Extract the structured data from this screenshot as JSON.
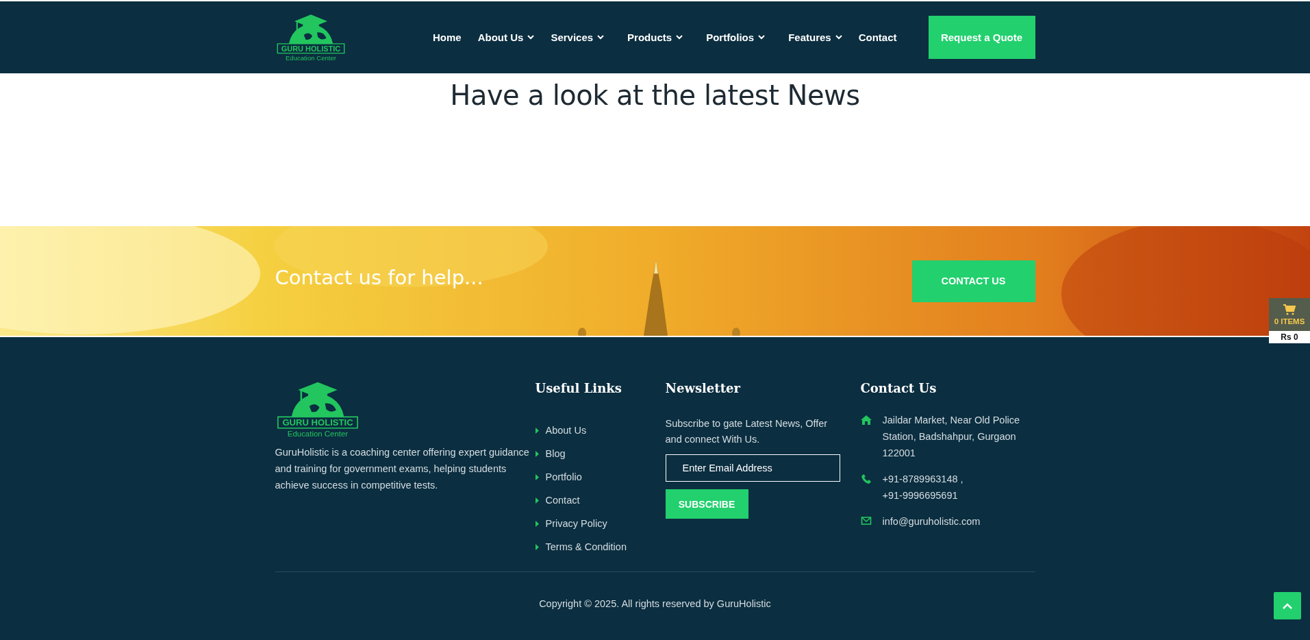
{
  "header": {
    "logo": {
      "name": "GURU HOLISTIC",
      "tagline": "Education Center"
    },
    "nav": [
      {
        "label": "Home",
        "dropdown": false
      },
      {
        "label": "About Us",
        "dropdown": true
      },
      {
        "label": "Services",
        "dropdown": true
      },
      {
        "label": "Products",
        "dropdown": true
      },
      {
        "label": "Portfolios",
        "dropdown": true
      },
      {
        "label": "Features",
        "dropdown": true
      },
      {
        "label": "Contact",
        "dropdown": false
      }
    ],
    "cta": "Request a Quote"
  },
  "news": {
    "heading": "Have a look at the latest News"
  },
  "banner": {
    "kind": "picture",
    "text": "Contact us for help...",
    "button": "CONTACT US"
  },
  "cart": {
    "count": "0 ITEMS",
    "total": "Rs 0"
  },
  "footer": {
    "about": {
      "logo": {
        "name": "GURU HOLISTIC",
        "tagline": "Education Center"
      },
      "text": "GuruHolistic is a coaching center offering expert guidance and training for government exams, helping students achieve success in competitive tests."
    },
    "links": {
      "title": "Useful Links",
      "items": [
        "About Us",
        "Blog",
        "Portfolio",
        "Contact",
        "Privacy Policy",
        "Terms & Condition"
      ]
    },
    "newsletter": {
      "title": "Newsletter",
      "text": "Subscribe to gate Latest News, Offer and connect With Us.",
      "placeholder": "Enter Email Address",
      "button": "SUBSCRIBE"
    },
    "contact": {
      "title": "Contact Us",
      "items": [
        {
          "kind": "address",
          "lines": [
            "Jaildar Market, Near Old Police Station, Badshahpur, Gurgaon 122001"
          ]
        },
        {
          "kind": "phone",
          "lines": [
            "+91-8789963148 ,",
            "+91-9996695691"
          ]
        },
        {
          "kind": "email",
          "lines": [
            "info@guruholistic.com"
          ]
        }
      ]
    },
    "copyright": "Copyright © 2025. All rights reserved by GuruHolistic"
  }
}
